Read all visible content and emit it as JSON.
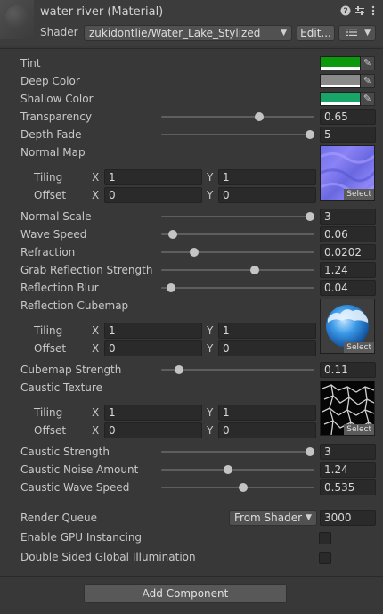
{
  "header": {
    "title": "water river (Material)",
    "shader_label": "Shader",
    "shader_value": "zukidontlie/Water_Lake_Stylized",
    "edit_button": "Edit...",
    "list_button_icon": "list-icon",
    "help_icon": "help-icon",
    "preset_icon": "sliders-icon",
    "menu_icon": "kebab-menu-icon"
  },
  "properties": {
    "tint": {
      "label": "Tint",
      "color": "#0c9a0c"
    },
    "deep_color": {
      "label": "Deep Color",
      "color": "#8a8a8a"
    },
    "shallow_color": {
      "label": "Shallow Color",
      "color": "#19a468"
    },
    "transparency": {
      "label": "Transparency",
      "value": "0.65",
      "fraction": 0.65
    },
    "depth_fade": {
      "label": "Depth Fade",
      "value": "5",
      "fraction": 1.0
    },
    "normal_map": {
      "label": "Normal Map",
      "tiling_label": "Tiling",
      "offset_label": "Offset",
      "tiling_x": "1",
      "tiling_y": "1",
      "offset_x": "0",
      "offset_y": "0",
      "select": "Select"
    },
    "normal_scale": {
      "label": "Normal Scale",
      "value": "3",
      "fraction": 1.0
    },
    "wave_speed": {
      "label": "Wave Speed",
      "value": "0.06",
      "fraction": 0.05
    },
    "refraction": {
      "label": "Refraction",
      "value": "0.0202",
      "fraction": 0.2
    },
    "grab_reflection_strength": {
      "label": "Grab Reflection Strength",
      "value": "1.24",
      "fraction": 0.62
    },
    "reflection_blur": {
      "label": "Reflection Blur",
      "value": "0.04",
      "fraction": 0.04
    },
    "reflection_cubemap": {
      "label": "Reflection Cubemap",
      "tiling_label": "Tiling",
      "offset_label": "Offset",
      "tiling_x": "1",
      "tiling_y": "1",
      "offset_x": "0",
      "offset_y": "0",
      "select": "Select"
    },
    "cubemap_strength": {
      "label": "Cubemap Strength",
      "value": "0.11",
      "fraction": 0.09
    },
    "caustic_texture": {
      "label": "Caustic Texture",
      "tiling_label": "Tiling",
      "offset_label": "Offset",
      "tiling_x": "1",
      "tiling_y": "1",
      "offset_x": "0",
      "offset_y": "0",
      "select": "Select"
    },
    "caustic_strength": {
      "label": "Caustic Strength",
      "value": "3",
      "fraction": 1.0
    },
    "caustic_noise_amount": {
      "label": "Caustic Noise Amount",
      "value": "1.24",
      "fraction": 0.43
    },
    "caustic_wave_speed": {
      "label": "Caustic Wave Speed",
      "value": "0.535",
      "fraction": 0.54
    }
  },
  "axis": {
    "x": "X",
    "y": "Y"
  },
  "render_queue": {
    "label": "Render Queue",
    "mode": "From Shader",
    "value": "3000"
  },
  "gpu_instancing": {
    "label": "Enable GPU Instancing",
    "checked": false
  },
  "double_sided_gi": {
    "label": "Double Sided Global Illumination",
    "checked": false
  },
  "footer": {
    "add_component": "Add Component"
  }
}
